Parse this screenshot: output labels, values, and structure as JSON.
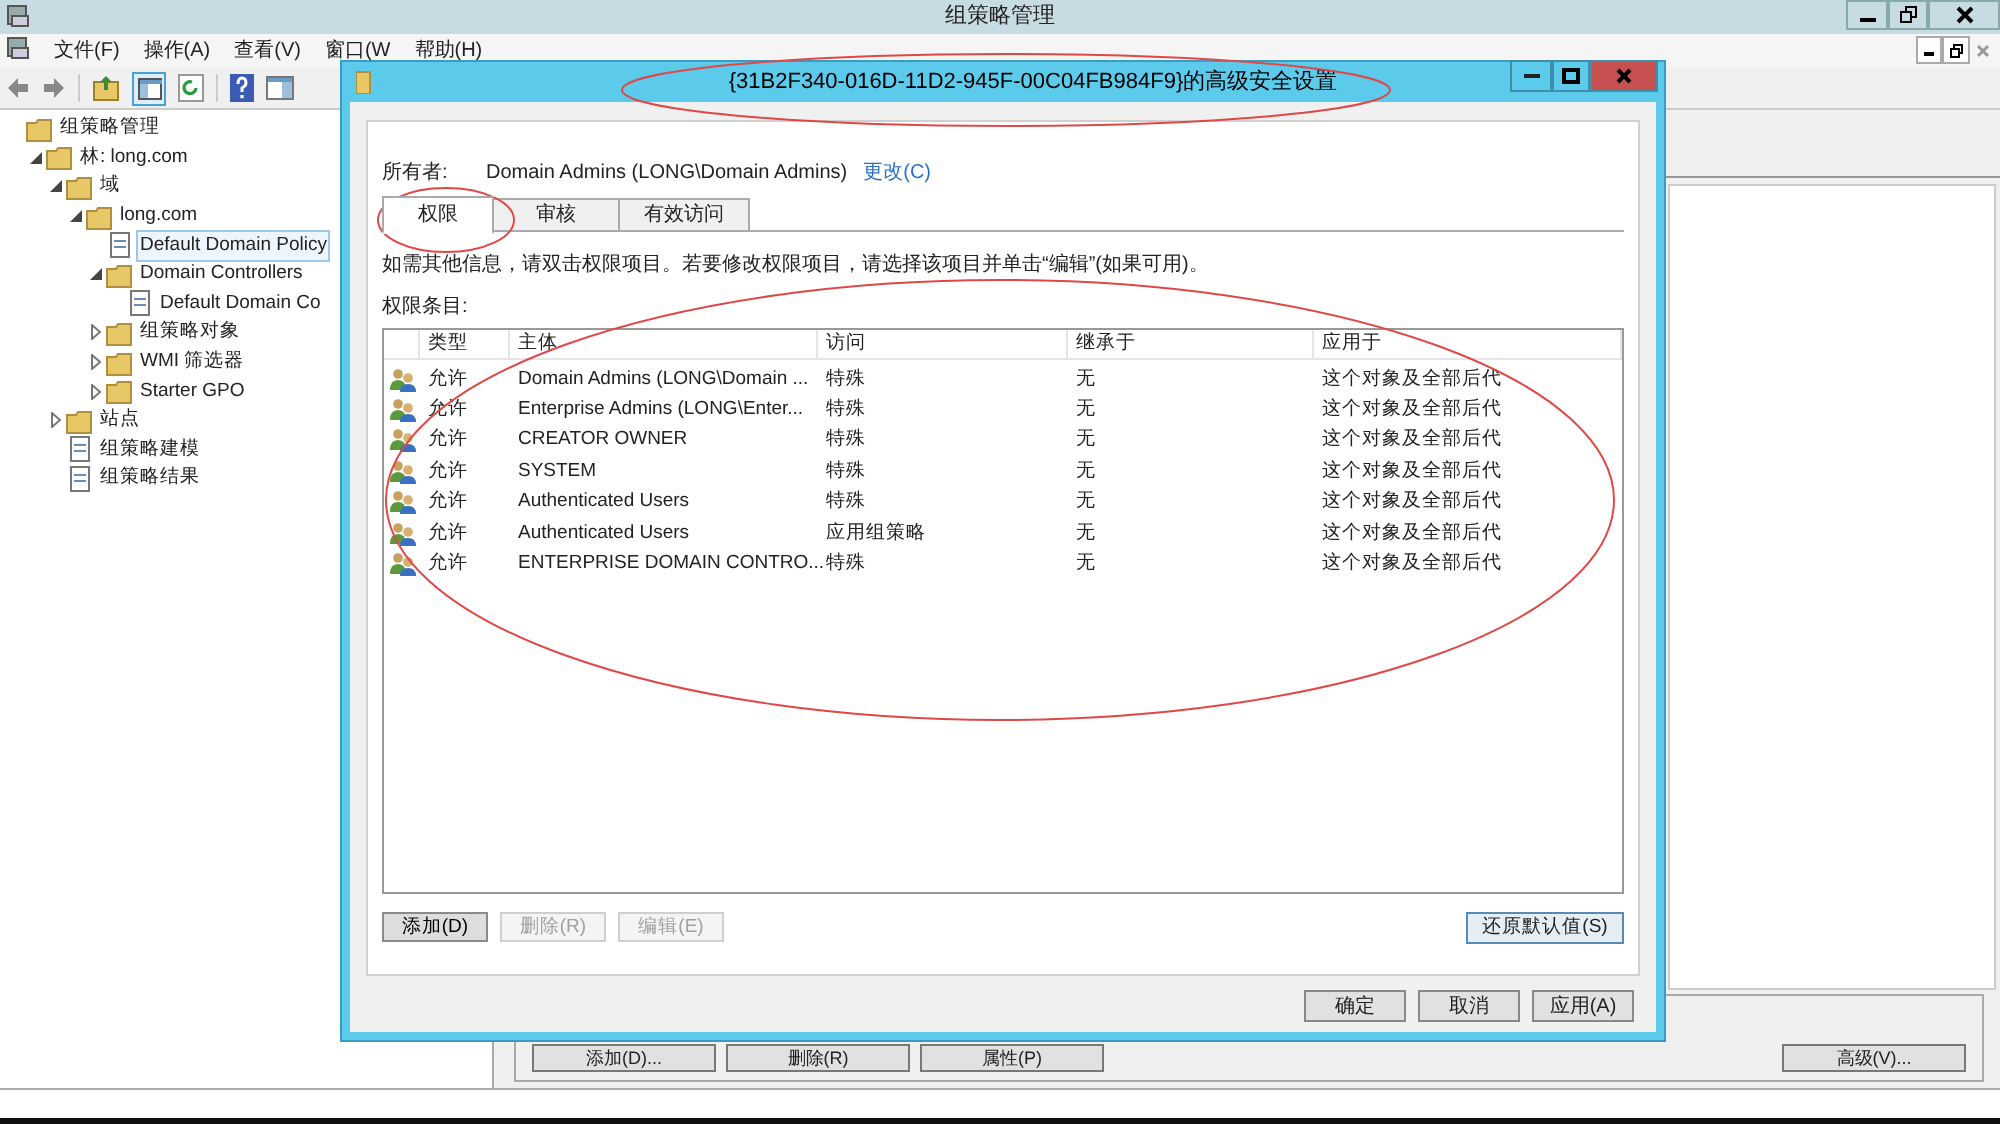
{
  "main_window": {
    "title": "组策略管理",
    "menu": [
      "文件(F)",
      "操作(A)",
      "查看(V)",
      "窗口(W",
      "帮助(H)"
    ],
    "tree": [
      {
        "label": "组策略管理",
        "selected": false,
        "children": [
          {
            "label": "林: long.com",
            "selected": false,
            "expanded": true,
            "children": [
              {
                "label": "域",
                "selected": false,
                "expanded": true,
                "children": [
                  {
                    "label": "long.com",
                    "selected": false,
                    "expanded": true,
                    "children": [
                      {
                        "label": "Default Domain Policy",
                        "selected": true
                      },
                      {
                        "label": "Domain Controllers",
                        "selected": false,
                        "expanded": true,
                        "children": [
                          {
                            "label": "Default Domain Co",
                            "selected": false
                          }
                        ]
                      },
                      {
                        "label": "组策略对象",
                        "selected": false,
                        "expanded": false
                      },
                      {
                        "label": "WMI 筛选器",
                        "selected": false,
                        "expanded": false
                      },
                      {
                        "label": "Starter GPO",
                        "selected": false,
                        "expanded": false
                      }
                    ]
                  }
                ]
              },
              {
                "label": "站点",
                "selected": false,
                "expanded": false
              },
              {
                "label": "组策略建模",
                "selected": false
              },
              {
                "label": "组策略结果",
                "selected": false
              }
            ]
          }
        ]
      }
    ],
    "bottom_buttons": [
      "添加(D)...",
      "删除(R)",
      "属性(P)",
      "高级(V)..."
    ]
  },
  "dialog": {
    "title": "{31B2F340-016D-11D2-945F-00C04FB984F9}的高级安全设置",
    "owner_label": "所有者:",
    "owner": "Domain Admins (LONG\\Domain Admins)",
    "change_link": "更改(C)",
    "tabs": [
      {
        "label": "权限",
        "selected": true
      },
      {
        "label": "审核",
        "selected": false
      },
      {
        "label": "有效访问",
        "selected": false
      }
    ],
    "info": "如需其他信息，请双击权限项目。若要修改权限项目，请选择该项目并单击“编辑”(如果可用)。",
    "list_label": "权限条目:",
    "table": {
      "columns": [
        "类型",
        "主体",
        "访问",
        "继承于",
        "应用于"
      ],
      "rows": [
        {
          "type": "允许",
          "principal": "Domain Admins (LONG\\Domain ...",
          "access": "特殊",
          "inherited_from": "无",
          "applies_to": "这个对象及全部后代"
        },
        {
          "type": "允许",
          "principal": "Enterprise Admins (LONG\\Enter...",
          "access": "特殊",
          "inherited_from": "无",
          "applies_to": "这个对象及全部后代"
        },
        {
          "type": "允许",
          "principal": "CREATOR OWNER",
          "access": "特殊",
          "inherited_from": "无",
          "applies_to": "这个对象及全部后代"
        },
        {
          "type": "允许",
          "principal": "SYSTEM",
          "access": "特殊",
          "inherited_from": "无",
          "applies_to": "这个对象及全部后代"
        },
        {
          "type": "允许",
          "principal": "Authenticated Users",
          "access": "特殊",
          "inherited_from": "无",
          "applies_to": "这个对象及全部后代"
        },
        {
          "type": "允许",
          "principal": "Authenticated Users",
          "access": "应用组策略",
          "inherited_from": "无",
          "applies_to": "这个对象及全部后代"
        },
        {
          "type": "允许",
          "principal": "ENTERPRISE DOMAIN CONTRO...",
          "access": "特殊",
          "inherited_from": "无",
          "applies_to": "这个对象及全部后代"
        }
      ]
    },
    "buttons": [
      {
        "label": "添加(D)",
        "disabled": false
      },
      {
        "label": "删除(R)",
        "disabled": true
      },
      {
        "label": "编辑(E)",
        "disabled": true
      }
    ],
    "restore_button": "还原默认值(S)",
    "footer_buttons": [
      "确定",
      "取消",
      "应用(A)"
    ]
  }
}
